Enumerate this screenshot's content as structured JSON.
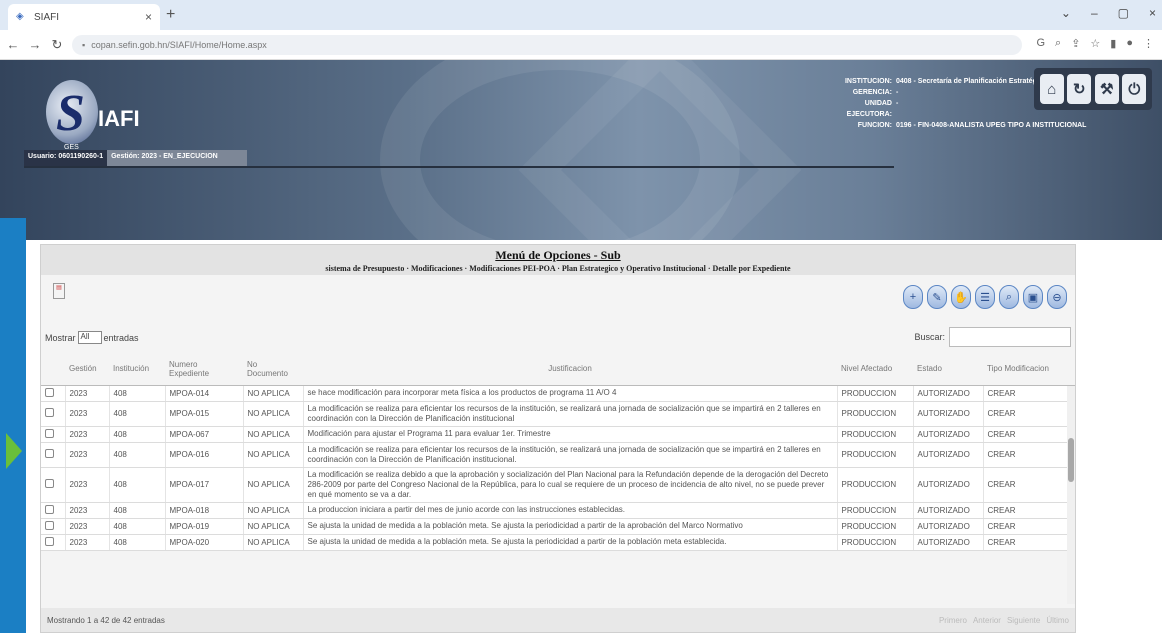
{
  "browser": {
    "tab_title": "SIAFI",
    "url": "copan.sefin.gob.hn/SIAFI/Home/Home.aspx"
  },
  "header": {
    "app_name": "IAFI",
    "logo_letter": "S",
    "logo_sub": "GES",
    "user_label": "Usuario: 0601190260-1",
    "gestion_label": "Gestión: 2023 - EN_EJECUCION",
    "institucion_key": "INSTITUCION:",
    "institucion_val": "0408 - Secretaría de Planificación Estratégica",
    "gerencia_key": "GERENCIA:",
    "gerencia_val": "-",
    "unidad_key": "UNIDAD EJECUTORA:",
    "unidad_val": "-",
    "funcion_key": "FUNCION:",
    "funcion_val": "0196 - FIN-0408-ANALISTA UPEG TIPO A INSTITUCIONAL"
  },
  "panel": {
    "title": "Menú de Opciones - Sub",
    "path": "sistema de Presupuesto · Modificaciones · Modificaciones PEI-POA · Plan Estrategico y Operativo Institucional · Detalle por Expediente",
    "mostrar_label": "Mostrar",
    "mostrar_value": "All",
    "entradas_label": "entradas",
    "buscar_label": "Buscar:"
  },
  "table": {
    "columns": [
      "",
      "Gestión",
      "Institución",
      "Numero Expediente",
      "No Documento",
      "Justificacion",
      "Nivel Afectado",
      "Estado",
      "Tipo Modificacion"
    ],
    "rows": [
      {
        "gestion": "2023",
        "inst": "408",
        "exp": "MPOA-014",
        "doc": "NO APLICA",
        "just": "se hace modificación para incorporar meta física a los productos de programa 11 A/O 4",
        "nivel": "PRODUCCION",
        "estado": "AUTORIZADO",
        "tipo": "CREAR"
      },
      {
        "gestion": "2023",
        "inst": "408",
        "exp": "MPOA-015",
        "doc": "NO APLICA",
        "just": "La modificación se realiza para eficientar los recursos de la institución, se realizará una jornada de socialización que se impartirá en 2 talleres en coordinación con la Dirección de Planificación institucional",
        "nivel": "PRODUCCION",
        "estado": "AUTORIZADO",
        "tipo": "CREAR"
      },
      {
        "gestion": "2023",
        "inst": "408",
        "exp": "MPOA-067",
        "doc": "NO APLICA",
        "just": "Modificación para ajustar el Programa 11 para evaluar 1er. Trimestre",
        "nivel": "PRODUCCION",
        "estado": "AUTORIZADO",
        "tipo": "CREAR"
      },
      {
        "gestion": "2023",
        "inst": "408",
        "exp": "MPOA-016",
        "doc": "NO APLICA",
        "just": "La modificación se realiza para eficientar los recursos de la institución, se realizará una jornada de socialización que se impartirá en 2 talleres en coordinación con la Dirección de Planificación institucional.",
        "nivel": "PRODUCCION",
        "estado": "AUTORIZADO",
        "tipo": "CREAR"
      },
      {
        "gestion": "2023",
        "inst": "408",
        "exp": "MPOA-017",
        "doc": "NO APLICA",
        "just": "La modificación se realiza debido a que la aprobación y socialización del Plan Nacional para la Refundación depende de la derogación del Decreto 286-2009 por parte del Congreso Nacional de la República, para lo cual se requiere de un proceso de incidencia de alto nivel, no se puede prever en qué momento se va a dar.",
        "nivel": "PRODUCCION",
        "estado": "AUTORIZADO",
        "tipo": "CREAR"
      },
      {
        "gestion": "2023",
        "inst": "408",
        "exp": "MPOA-018",
        "doc": "NO APLICA",
        "just": "La produccion iniciara a partir del mes de junio acorde con las instrucciones establecidas.",
        "nivel": "PRODUCCION",
        "estado": "AUTORIZADO",
        "tipo": "CREAR"
      },
      {
        "gestion": "2023",
        "inst": "408",
        "exp": "MPOA-019",
        "doc": "NO APLICA",
        "just": "Se ajusta la unidad de medida a la población meta. Se ajusta la periodicidad a partir de la aprobación del Marco Normativo",
        "nivel": "PRODUCCION",
        "estado": "AUTORIZADO",
        "tipo": "CREAR"
      },
      {
        "gestion": "2023",
        "inst": "408",
        "exp": "MPOA-020",
        "doc": "NO APLICA",
        "just": "Se ajusta la unidad de medida a la población meta. Se ajusta la periodicidad a partir de la población meta establecida.",
        "nivel": "PRODUCCION",
        "estado": "AUTORIZADO",
        "tipo": "CREAR"
      }
    ]
  },
  "footer": {
    "info": "Mostrando 1 a 42 de 42 entradas",
    "first": "Primero",
    "prev": "Anterior",
    "next": "Siguiente",
    "last": "Último"
  }
}
